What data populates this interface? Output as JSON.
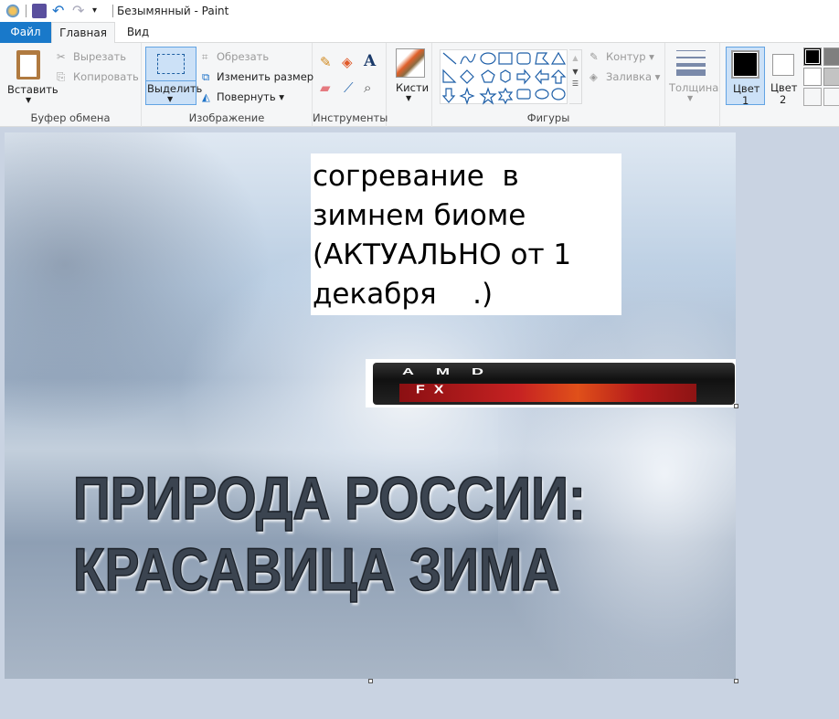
{
  "window": {
    "title": "Безымянный - Paint"
  },
  "tabs": [
    {
      "label": "Файл"
    },
    {
      "label": "Главная"
    },
    {
      "label": "Вид"
    }
  ],
  "clipboard": {
    "paste": "Вставить",
    "cut": "Вырезать",
    "copy": "Копировать",
    "group": "Буфер обмена"
  },
  "image": {
    "select": "Выделить",
    "crop": "Обрезать",
    "resize": "Изменить размер",
    "rotate": "Повернуть",
    "group": "Изображение"
  },
  "tools": {
    "group": "Инструменты"
  },
  "brushes": {
    "label": "Кисти"
  },
  "shapes": {
    "outline": "Контур",
    "fill": "Заливка",
    "group": "Фигуры"
  },
  "size": {
    "label": "Толщина"
  },
  "colors": {
    "color1_a": "Цвет",
    "color1_b": "1",
    "color2_a": "Цвет",
    "color2_b": "2",
    "color1": "#000000",
    "color2": "#ffffff",
    "palette": [
      "#000000",
      "#7f7f7f",
      "#ffffff",
      "#c3c3c3"
    ]
  },
  "canvas": {
    "textbox": "согревание  в\nзимнем биоме\n(АКТУАЛЬНО от 1\nдекабря    .)",
    "logo_line1": "AMD",
    "logo_line2": "FX",
    "title_line1": "ПРИРОДА РОССИИ:",
    "title_line2": "КРАСАВИЦА ЗИМА"
  }
}
